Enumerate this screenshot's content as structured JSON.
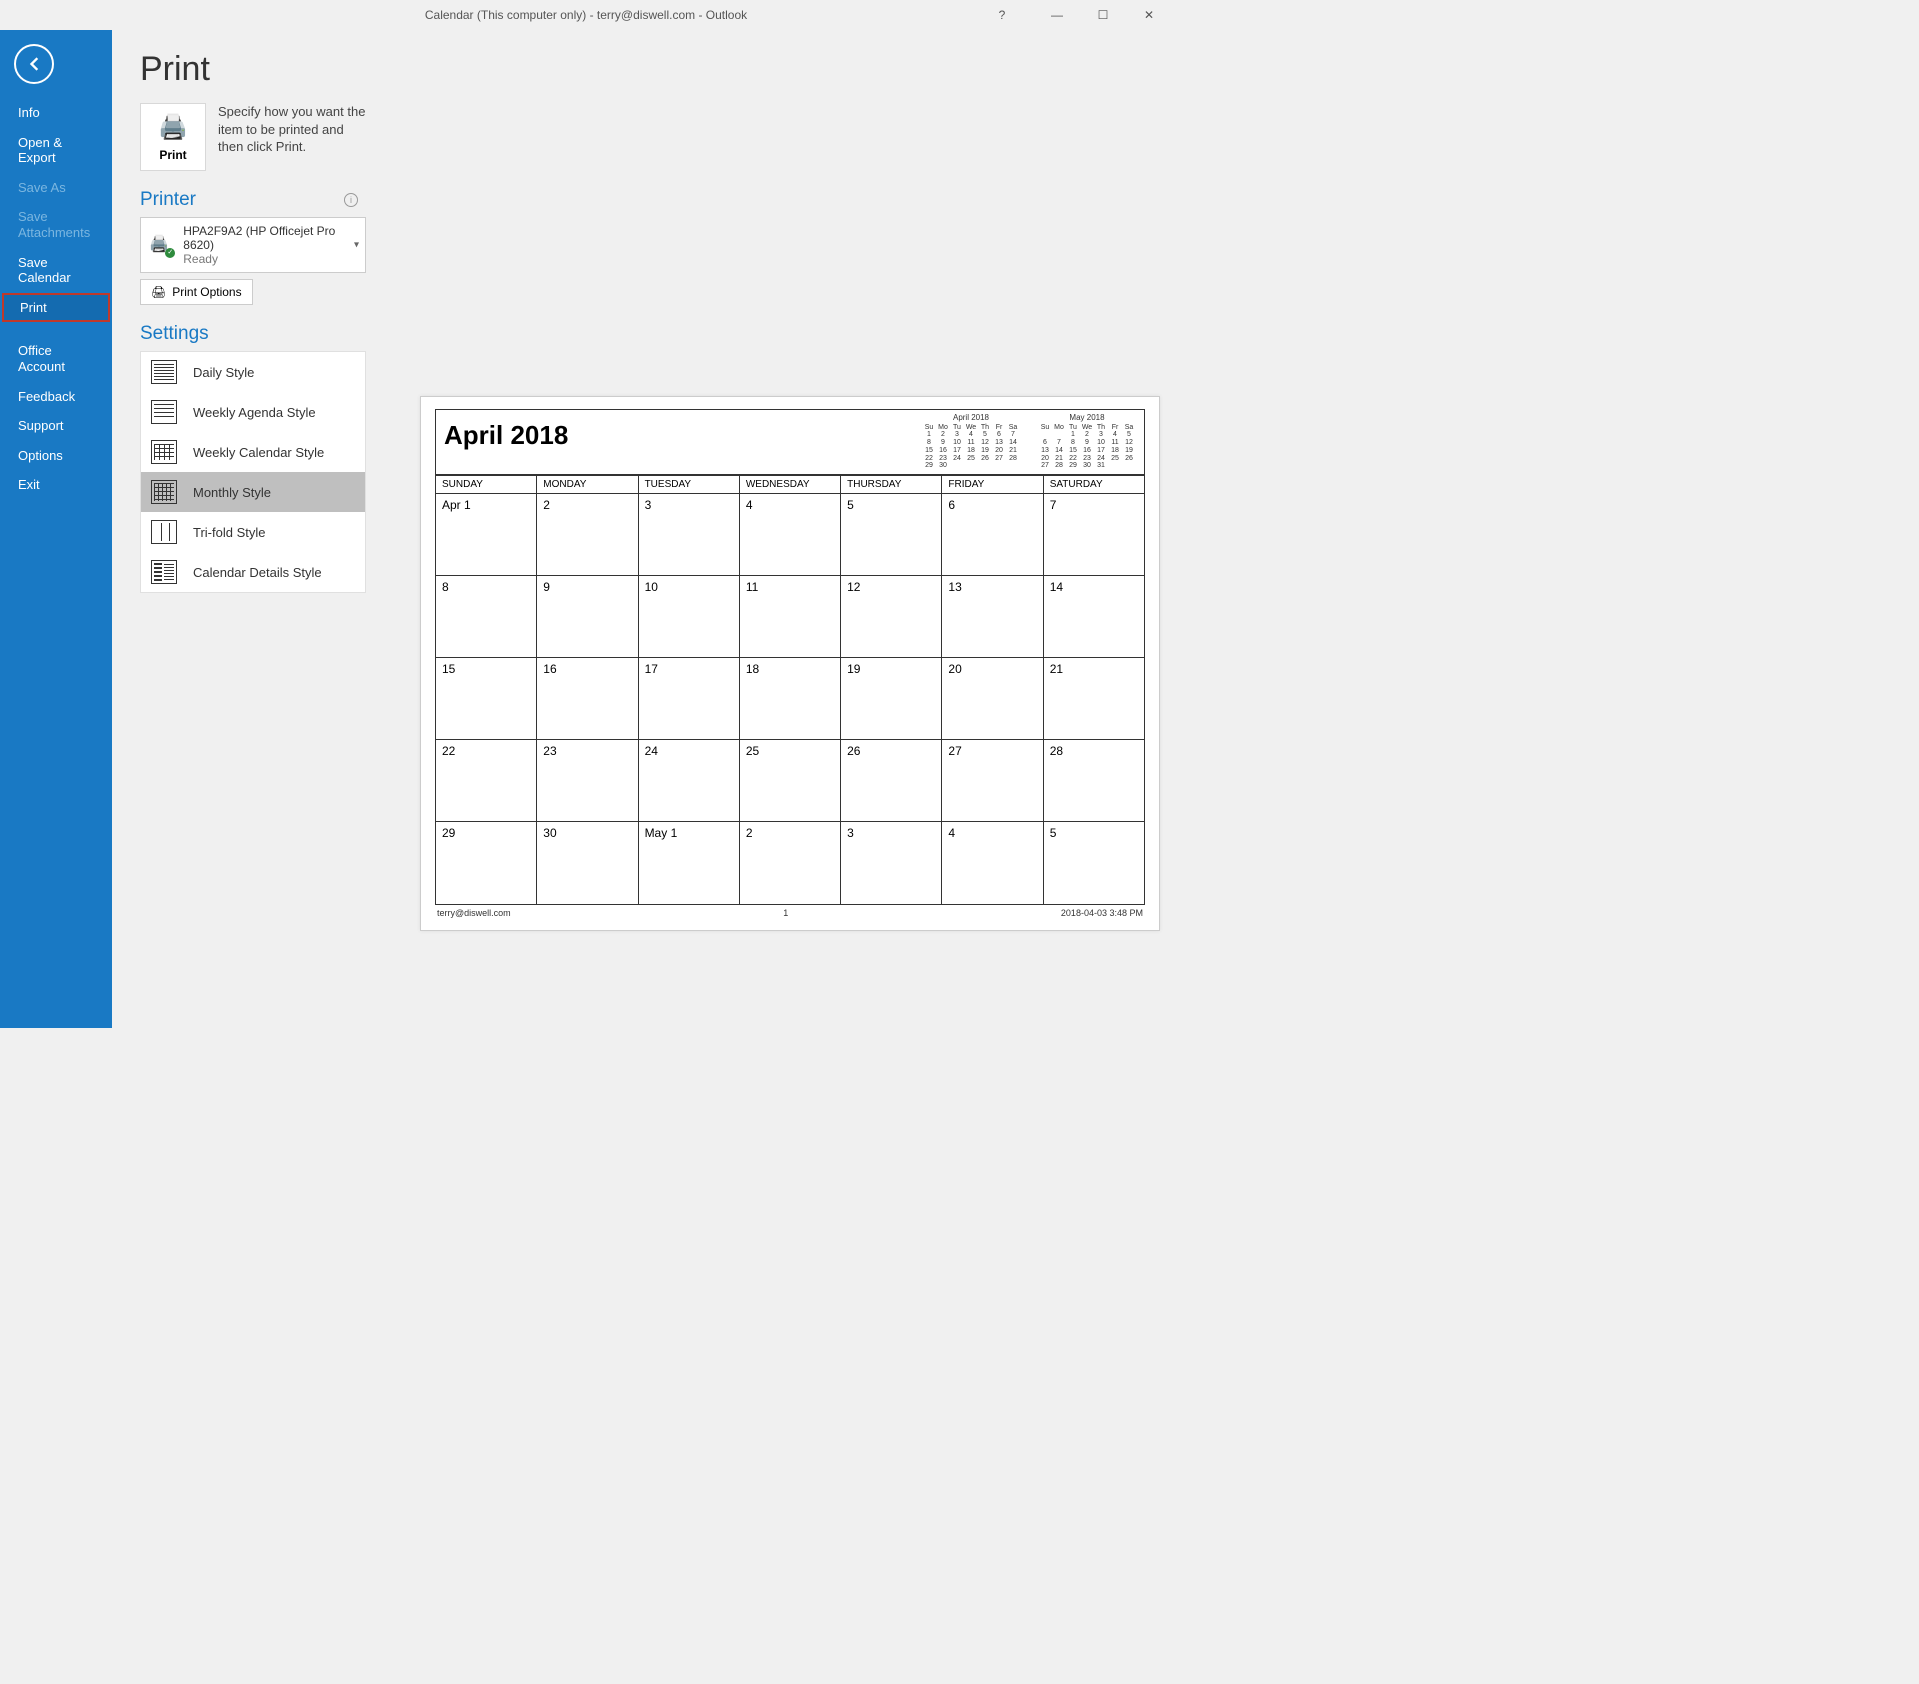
{
  "window": {
    "title": "Calendar (This computer only) - terry@diswell.com  -  Outlook",
    "help": "?",
    "minimize": "—",
    "maximize": "☐",
    "close": "✕"
  },
  "sidebar": {
    "items": [
      {
        "label": "Info",
        "disabled": false
      },
      {
        "label": "Open & Export",
        "disabled": false
      },
      {
        "label": "Save As",
        "disabled": true
      },
      {
        "label": "Save Attachments",
        "disabled": true
      },
      {
        "label": "Save Calendar",
        "disabled": false
      },
      {
        "label": "Print",
        "disabled": false,
        "selected": true
      },
      {
        "label": "Office Account",
        "disabled": false,
        "twoLine": true
      },
      {
        "label": "Feedback",
        "disabled": false
      },
      {
        "label": "Support",
        "disabled": false
      },
      {
        "label": "Options",
        "disabled": false
      },
      {
        "label": "Exit",
        "disabled": false
      }
    ]
  },
  "page": {
    "title": "Print",
    "printButton": "Print",
    "description": "Specify how you want the item to be printed and then click Print."
  },
  "printer": {
    "heading": "Printer",
    "name": "HPA2F9A2 (HP Officejet Pro 8620)",
    "status": "Ready",
    "optionsButton": "Print Options"
  },
  "settings": {
    "heading": "Settings",
    "styles": [
      {
        "label": "Daily Style",
        "icon": "daily"
      },
      {
        "label": "Weekly Agenda Style",
        "icon": "agenda"
      },
      {
        "label": "Weekly Calendar Style",
        "icon": "weekcal"
      },
      {
        "label": "Monthly Style",
        "icon": "monthly",
        "selected": true
      },
      {
        "label": "Tri-fold Style",
        "icon": "trifold"
      },
      {
        "label": "Calendar Details Style",
        "icon": "details"
      }
    ]
  },
  "preview": {
    "title": "April 2018",
    "dow": [
      "SUNDAY",
      "MONDAY",
      "TUESDAY",
      "WEDNESDAY",
      "THURSDAY",
      "FRIDAY",
      "SATURDAY"
    ],
    "weeks": [
      [
        "Apr 1",
        "2",
        "3",
        "4",
        "5",
        "6",
        "7"
      ],
      [
        "8",
        "9",
        "10",
        "11",
        "12",
        "13",
        "14"
      ],
      [
        "15",
        "16",
        "17",
        "18",
        "19",
        "20",
        "21"
      ],
      [
        "22",
        "23",
        "24",
        "25",
        "26",
        "27",
        "28"
      ],
      [
        "29",
        "30",
        "May 1",
        "2",
        "3",
        "4",
        "5"
      ]
    ],
    "footer": {
      "left": "terry@diswell.com",
      "center": "1",
      "right": "2018-04-03 3:48 PM"
    },
    "miniCals": [
      {
        "title": "April 2018",
        "dow": [
          "Su",
          "Mo",
          "Tu",
          "We",
          "Th",
          "Fr",
          "Sa"
        ],
        "rows": [
          [
            "1",
            "2",
            "3",
            "4",
            "5",
            "6",
            "7"
          ],
          [
            "8",
            "9",
            "10",
            "11",
            "12",
            "13",
            "14"
          ],
          [
            "15",
            "16",
            "17",
            "18",
            "19",
            "20",
            "21"
          ],
          [
            "22",
            "23",
            "24",
            "25",
            "26",
            "27",
            "28"
          ],
          [
            "29",
            "30",
            "",
            "",
            "",
            "",
            ""
          ]
        ]
      },
      {
        "title": "May 2018",
        "dow": [
          "Su",
          "Mo",
          "Tu",
          "We",
          "Th",
          "Fr",
          "Sa"
        ],
        "rows": [
          [
            "",
            "",
            "1",
            "2",
            "3",
            "4",
            "5"
          ],
          [
            "6",
            "7",
            "8",
            "9",
            "10",
            "11",
            "12"
          ],
          [
            "13",
            "14",
            "15",
            "16",
            "17",
            "18",
            "19"
          ],
          [
            "20",
            "21",
            "22",
            "23",
            "24",
            "25",
            "26"
          ],
          [
            "27",
            "28",
            "29",
            "30",
            "31",
            "",
            ""
          ]
        ]
      }
    ]
  }
}
